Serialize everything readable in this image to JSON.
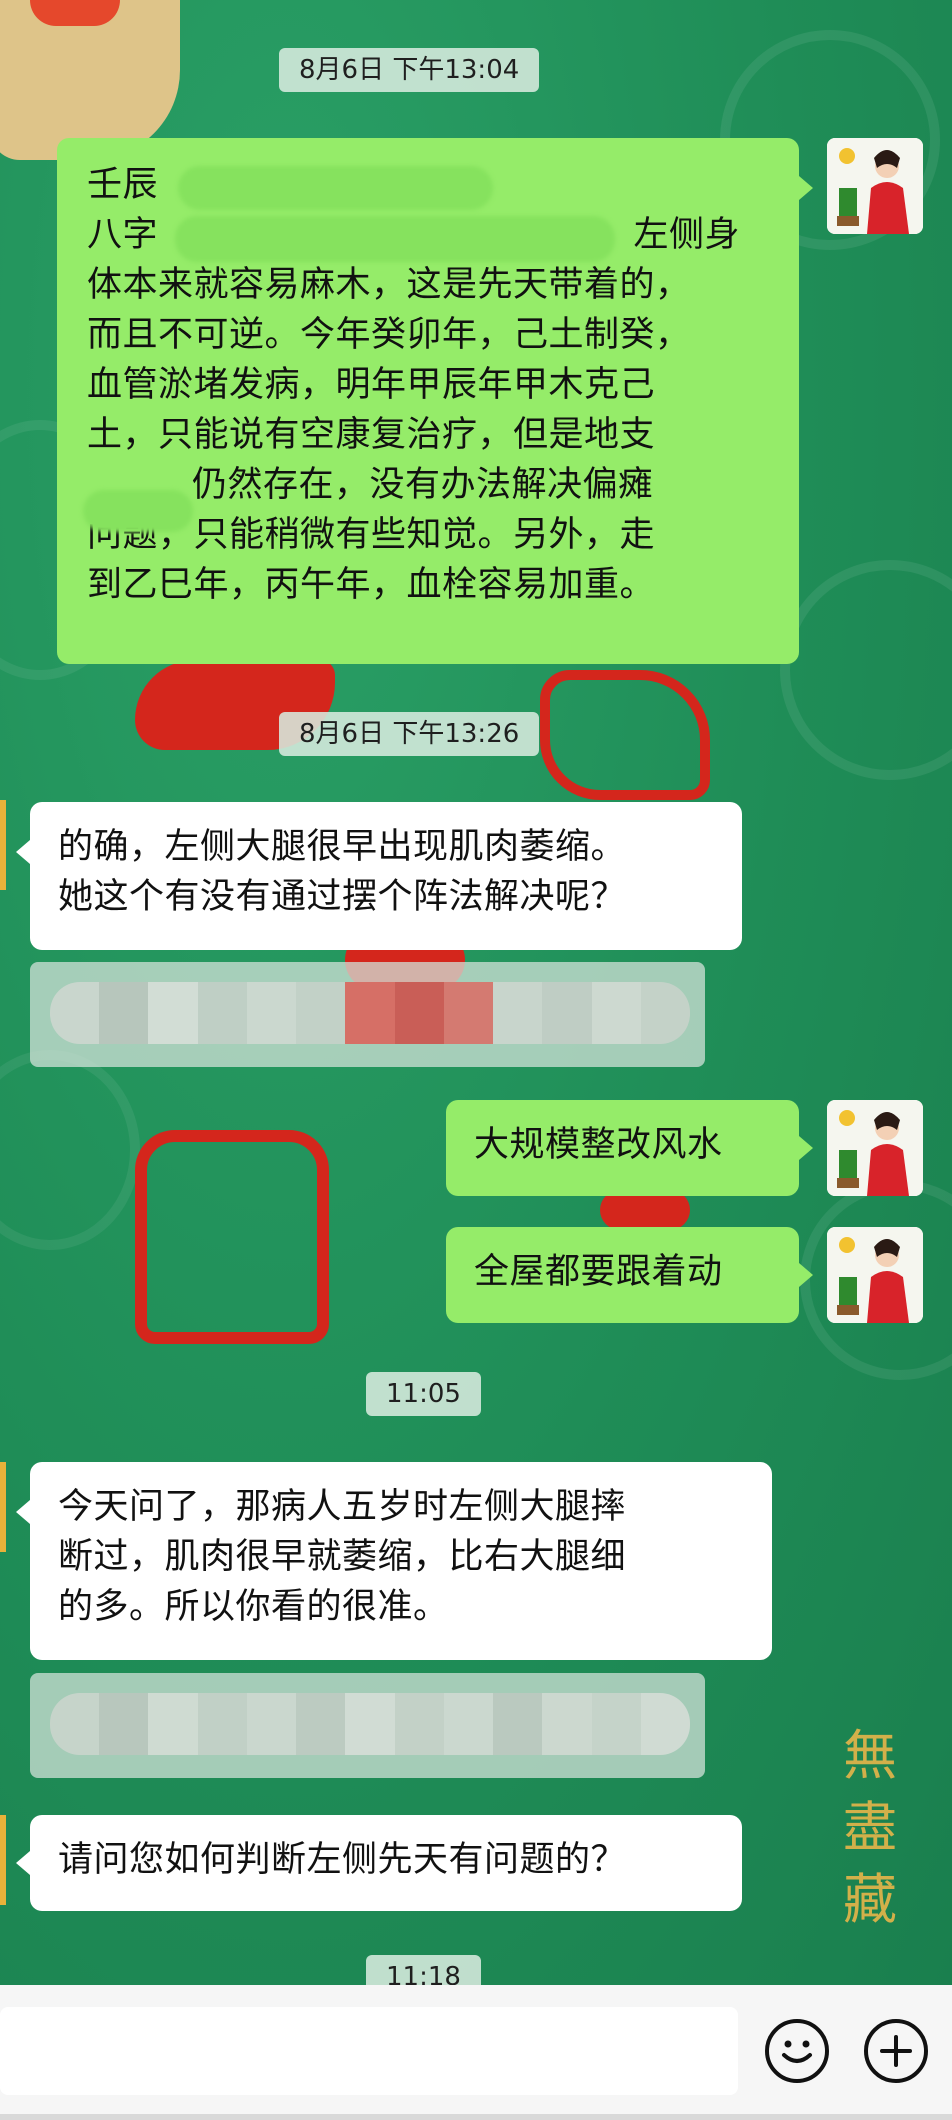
{
  "timestamps": {
    "t1": "8月6日  下午13:04",
    "t2": "8月6日  下午13:26",
    "t3": "11:05",
    "t4": "11:18"
  },
  "messages": {
    "m1": {
      "line1": "壬辰",
      "line2_prefix": "八字",
      "line2_suffix": "，左侧身",
      "line3": "体本来就容易麻木，这是先天带着的，",
      "line4": "而且不可逆。今年癸卯年，己土制癸，",
      "line5": "血管淤堵发病，明年甲辰年甲木克己",
      "line6": "土，只能说有空康复治疗，但是地支",
      "line7_suffix": "仍然存在，没有办法解决偏瘫",
      "line8": "问题，只能稍微有些知觉。另外，走",
      "line9": "到乙巳年，丙午年，血栓容易加重。"
    },
    "m2": {
      "line1": "的确，左侧大腿很早出现肌肉萎缩。",
      "line2": "她这个有没有通过摆个阵法解决呢？"
    },
    "m3": {
      "text": "大规模整改风水"
    },
    "m4": {
      "text": "全屋都要跟着动"
    },
    "m5": {
      "line1": "今天问了，那病人五岁时左侧大腿摔",
      "line2": "断过，肌肉很早就萎缩，比右大腿细",
      "line3": "的多。所以你看的很准。"
    },
    "m6": {
      "text": "请问您如何判断左侧先天有问题的？"
    }
  },
  "background": {
    "calligraphy_1": "無",
    "calligraphy_2": "盡",
    "calligraphy_3": "藏"
  },
  "icons": {
    "emoji": "emoji-icon",
    "plus": "plus-icon"
  },
  "colors": {
    "chat_background": "#23935c",
    "outgoing_bubble": "#95ec69",
    "incoming_bubble": "#ffffff",
    "timestamp_bg": "#d7ebde"
  }
}
